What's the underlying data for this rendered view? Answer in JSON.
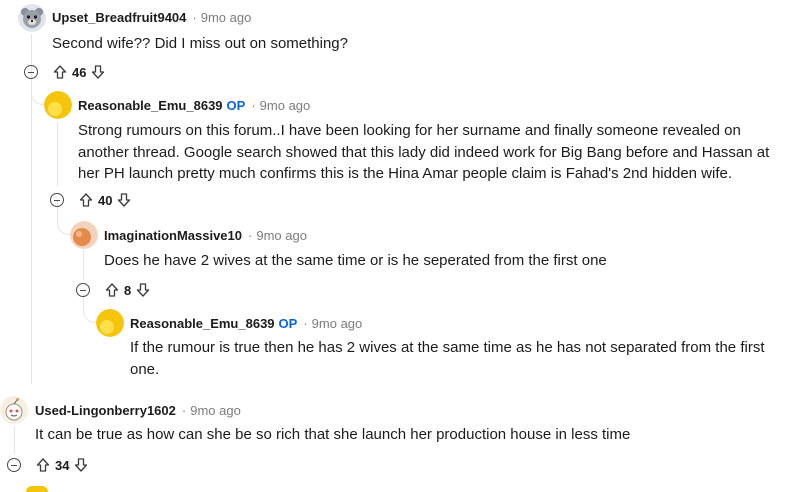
{
  "comments": [
    {
      "username": "Upset_Breadfruit9404",
      "op": "",
      "time": "9mo ago",
      "text": "Second wife?? Did I miss out on something?",
      "votes": "46",
      "avatar": "bear-avatar-icon"
    },
    {
      "username": "Reasonable_Emu_8639",
      "op": "OP",
      "time": "9mo ago",
      "text": "Strong rumours on this forum..I have been looking for her surname and finally someone revealed on another thread. Google search showed that this lady did indeed work for Big Bang before and Hassan at her PH launch pretty much confirms this is the Hina Amar people claim is Fahad's 2nd hidden wife.",
      "votes": "40",
      "avatar": "yellow-avatar-icon"
    },
    {
      "username": "ImaginationMassive10",
      "op": "",
      "time": "9mo ago",
      "text": "Does he have 2 wives at the same time or is he seperated from the first one",
      "votes": "8",
      "avatar": "orange-avatar-icon"
    },
    {
      "username": "Reasonable_Emu_8639",
      "op": "OP",
      "time": "9mo ago",
      "text": "If the rumour is true then he has 2 wives at the same time as he has not separated from the first one.",
      "votes": "",
      "avatar": "yellow-avatar-icon"
    },
    {
      "username": "Used-Lingonberry1602",
      "op": "",
      "time": "9mo ago",
      "text": "It can be true as how can she be so rich that she launch her production house in less time",
      "votes": "34",
      "avatar": "snoo-avatar-icon"
    }
  ],
  "separator": "·",
  "colors": {
    "op": "#0a66d8",
    "meta": "#7c7c7c",
    "line": "#e2e5e8",
    "avatar_yellow": "#f5c50c",
    "avatar_orange": "#e58a4a"
  }
}
